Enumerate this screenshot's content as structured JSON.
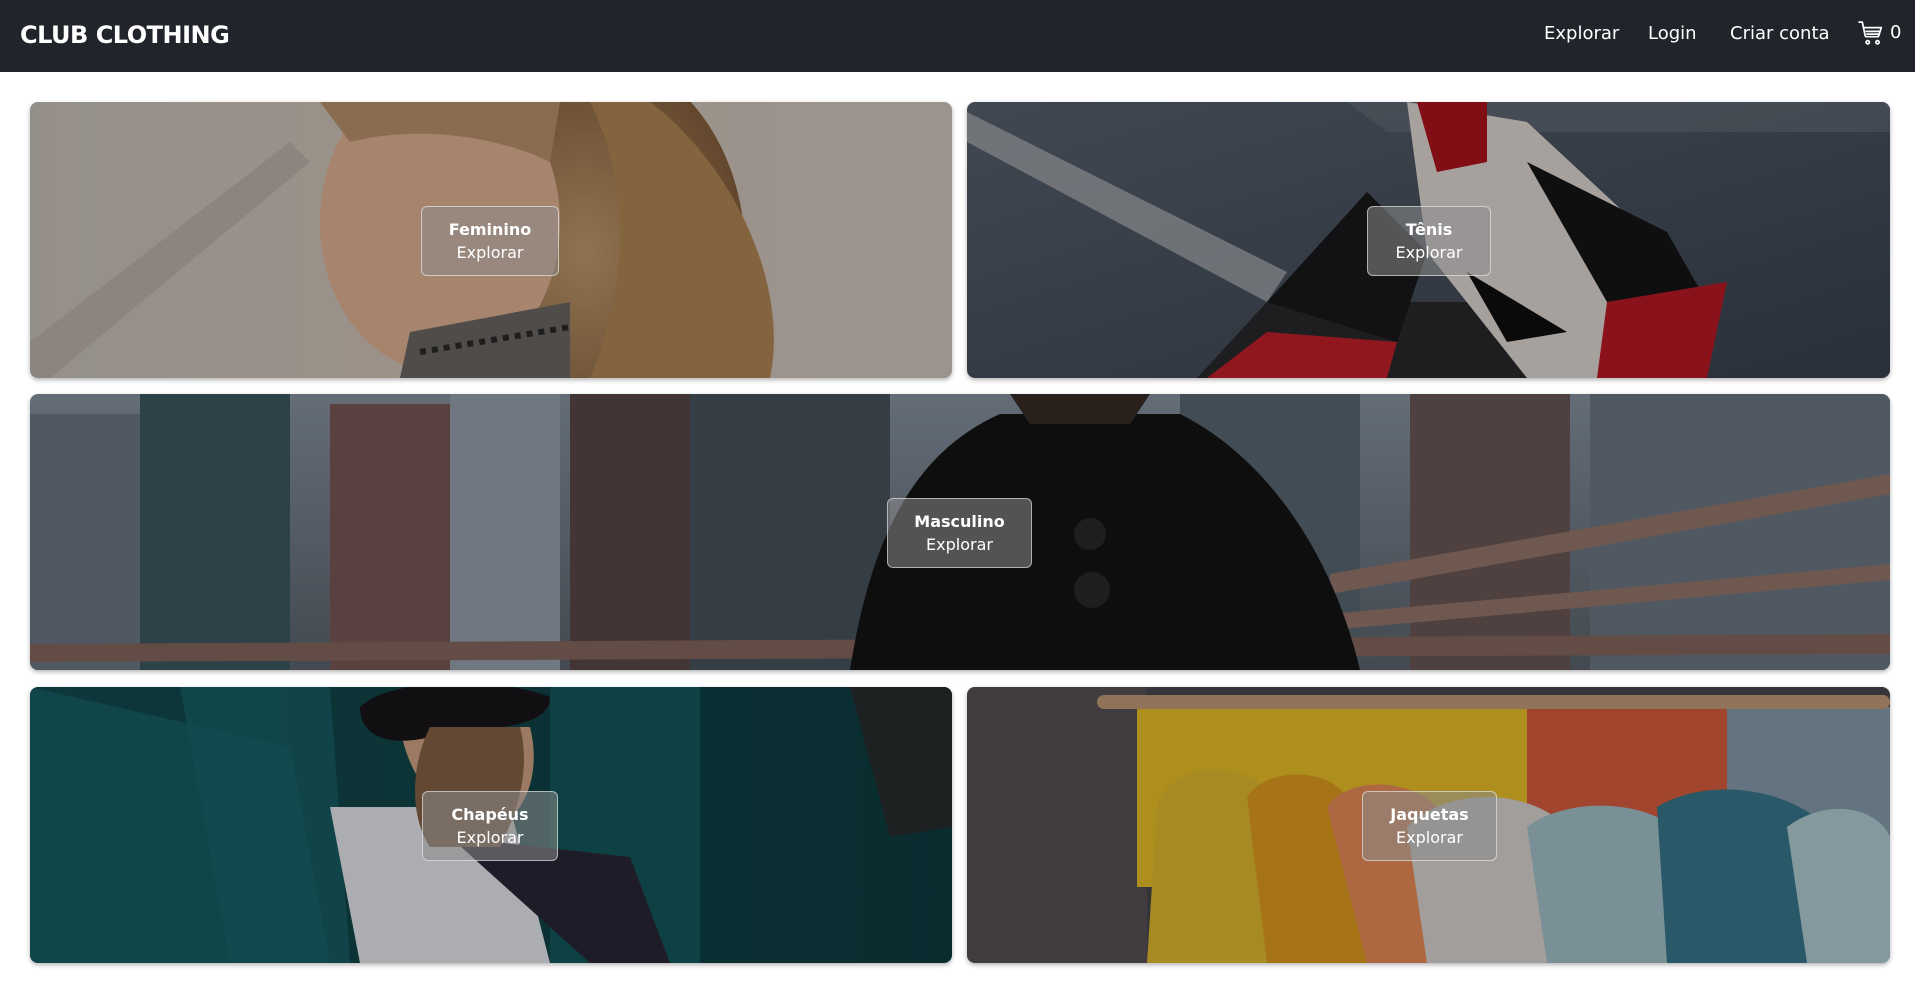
{
  "header": {
    "logo": "CLUB CLOTHING",
    "nav": {
      "explorar": "Explorar",
      "login": "Login",
      "criar_conta": "Criar conta"
    },
    "cart": {
      "icon": "shopping-cart-icon",
      "count": "0"
    }
  },
  "categories": [
    {
      "title": "Feminino",
      "action": "Explorar"
    },
    {
      "title": "Tênis",
      "action": "Explorar"
    },
    {
      "title": "Masculino",
      "action": "Explorar"
    },
    {
      "title": "Chapéus",
      "action": "Explorar"
    },
    {
      "title": "Jaquetas",
      "action": "Explorar"
    }
  ],
  "colors": {
    "header_bg": "#21252b",
    "header_text": "#ffffff",
    "page_bg": "#ffffff"
  }
}
